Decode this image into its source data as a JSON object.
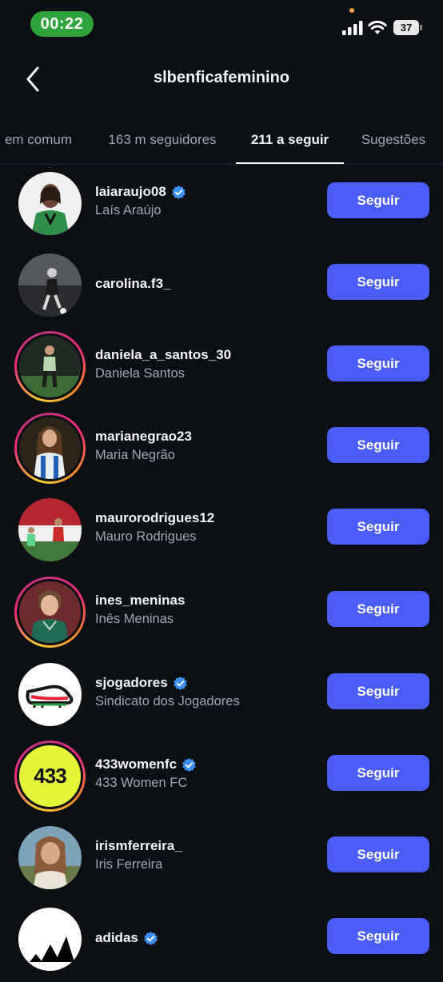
{
  "status_bar": {
    "time": "00:22",
    "battery": "37",
    "colors": {
      "time_pill": "#2fa33b",
      "privacy_dot": "#f0a33a"
    }
  },
  "header": {
    "title": "slbenficafeminino",
    "back_icon": "chevron-left-icon"
  },
  "tabs": [
    {
      "label": "em comum"
    },
    {
      "label": "163 m seguidores"
    },
    {
      "label": "211 a seguir",
      "active": true
    },
    {
      "label": "Sugestões"
    }
  ],
  "accent_color": "#4a5df9",
  "accounts": [
    {
      "username": "laiaraujo08",
      "name": "Laís Araújo",
      "verified": true,
      "story_ring": false,
      "button": "Seguir"
    },
    {
      "username": "carolina.f3_",
      "name": "",
      "verified": false,
      "story_ring": false,
      "button": "Seguir"
    },
    {
      "username": "daniela_a_santos_30",
      "name": "Daniela Santos",
      "verified": false,
      "story_ring": true,
      "button": "Seguir"
    },
    {
      "username": "marianegrao23",
      "name": "Maria Negrão",
      "verified": false,
      "story_ring": true,
      "button": "Seguir"
    },
    {
      "username": "maurorodrigues12",
      "name": "Mauro Rodrigues",
      "verified": false,
      "story_ring": false,
      "button": "Seguir"
    },
    {
      "username": "ines_meninas",
      "name": "Inês Meninas",
      "verified": false,
      "story_ring": true,
      "button": "Seguir"
    },
    {
      "username": "sjogadores",
      "name": "Sindicato dos Jogadores",
      "verified": true,
      "story_ring": false,
      "button": "Seguir"
    },
    {
      "username": "433womenfc",
      "name": "433 Women FC",
      "verified": true,
      "story_ring": true,
      "button": "Seguir",
      "logo_text": "433"
    },
    {
      "username": "irismferreira_",
      "name": "Iris Ferreira",
      "verified": false,
      "story_ring": false,
      "button": "Seguir"
    },
    {
      "username": "adidas",
      "name": "",
      "verified": true,
      "story_ring": false,
      "button": "Seguir"
    }
  ]
}
